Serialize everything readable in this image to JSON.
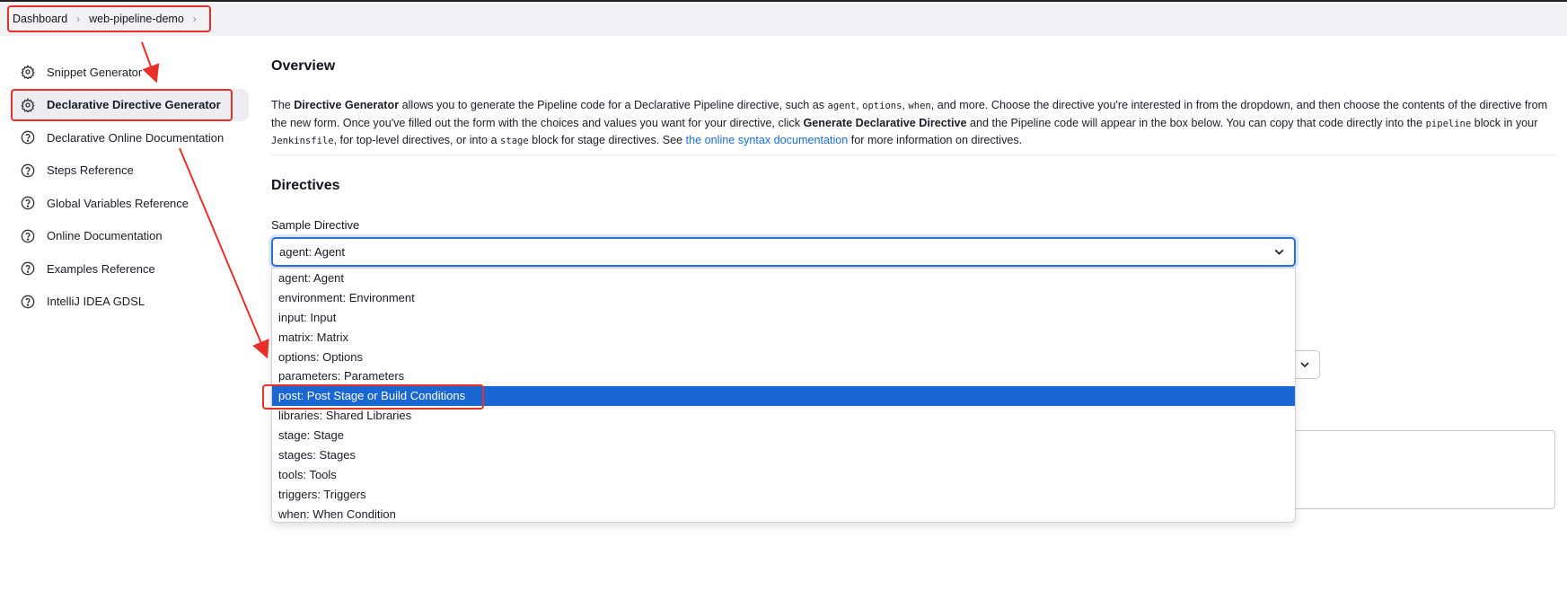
{
  "breadcrumb": {
    "items": [
      "Dashboard",
      "web-pipeline-demo"
    ]
  },
  "sidebar": {
    "items": [
      {
        "label": "Snippet Generator",
        "icon": "gear-icon"
      },
      {
        "label": "Declarative Directive Generator",
        "icon": "gear-icon",
        "active": true
      },
      {
        "label": "Declarative Online Documentation",
        "icon": "help-icon"
      },
      {
        "label": "Steps Reference",
        "icon": "help-icon"
      },
      {
        "label": "Global Variables Reference",
        "icon": "help-icon"
      },
      {
        "label": "Online Documentation",
        "icon": "help-icon"
      },
      {
        "label": "Examples Reference",
        "icon": "help-icon"
      },
      {
        "label": "IntelliJ IDEA GDSL",
        "icon": "help-icon"
      }
    ]
  },
  "overview": {
    "heading": "Overview",
    "t1": "The ",
    "b1": "Directive Generator",
    "t2": " allows you to generate the Pipeline code for a Declarative Pipeline directive, such as ",
    "c1": "agent",
    "t3": ", ",
    "c2": "options",
    "t4": ", ",
    "c3": "when",
    "t5": ", and more. Choose the directive you're interested in from the dropdown, and then choose the contents of the directive from the new form. Once you've filled out the form with the choices and values you want for your directive, click ",
    "b2": "Generate Declarative Directive",
    "t6": " and the Pipeline code will appear in the box below. You can copy that code directly into the ",
    "c4": "pipeline",
    "t7": " block in your ",
    "c5": "Jenkinsfile",
    "t8": ", for top-level directives, or into a ",
    "c6": "stage",
    "t9": " block for stage directives. See ",
    "link": "the online syntax documentation",
    "t10": " for more information on directives."
  },
  "directives": {
    "heading": "Directives",
    "sample_label": "Sample Directive",
    "selected": "agent: Agent",
    "options": [
      "agent: Agent",
      "environment: Environment",
      "input: Input",
      "matrix: Matrix",
      "options: Options",
      "parameters: Parameters",
      "post: Post Stage or Build Conditions",
      "libraries: Shared Libraries",
      "stage: Stage",
      "stages: Stages",
      "tools: Tools",
      "triggers: Triggers",
      "when: When Condition"
    ],
    "highlighted_option": "post: Post Stage or Build Conditions"
  },
  "colors": {
    "accent": "#1a66d2",
    "annotation": "#e8302a",
    "link": "#1a6fd0"
  }
}
